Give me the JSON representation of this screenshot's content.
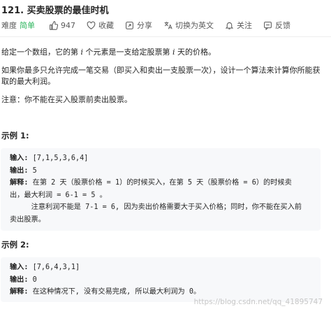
{
  "problem": {
    "title": "121. 买卖股票的最佳时机"
  },
  "meta": {
    "difficulty_label": "难度",
    "difficulty": "简单",
    "likes": "947",
    "favorite": "收藏",
    "share": "分享",
    "translate": "切换为英文",
    "follow": "关注",
    "feedback": "反馈"
  },
  "description": {
    "line1_a": "给定一个数组，它的第 ",
    "line1_i": "i",
    "line1_b": " 个元素是一支给定股票第 ",
    "line1_i2": "i",
    "line1_c": " 天的价格。",
    "line2": "如果你最多只允许完成一笔交易（即买入和卖出一支股票一次），设计一个算法来计算你所能获",
    "line3": "取的最大利润。",
    "note": "注意：你不能在买入股票前卖出股票。"
  },
  "example1": {
    "title": "示例 1:",
    "input_label": "输入:",
    "input_value": " [7,1,5,3,6,4]",
    "output_label": "输出:",
    "output_value": " 5",
    "expl_label": "解释:",
    "expl_line1": " 在第 2 天（股票价格 = 1）的时候买入，在第 5 天（股票价格 = 6）的时候卖",
    "expl_line2": "出，最大利润 = 6-1 = 5 。",
    "expl_line3": "     注意利润不能是 7-1 = 6, 因为卖出价格需要大于买入价格；同时，你不能在买入前",
    "expl_line4": "卖出股票。"
  },
  "example2": {
    "title": "示例 2:",
    "input_label": "输入:",
    "input_value": " [7,6,4,3,1]",
    "output_label": "输出:",
    "output_value": " 0",
    "expl_label": "解释:",
    "expl_line1": " 在这种情况下, 没有交易完成, 所以最大利润为 0。"
  },
  "watermark": "https://blog.csdn.net/qq_41895747",
  "colors": {
    "easy": "#2db55d",
    "text": "#262626",
    "muted": "#595959",
    "code_bg": "#f7f8fa"
  }
}
